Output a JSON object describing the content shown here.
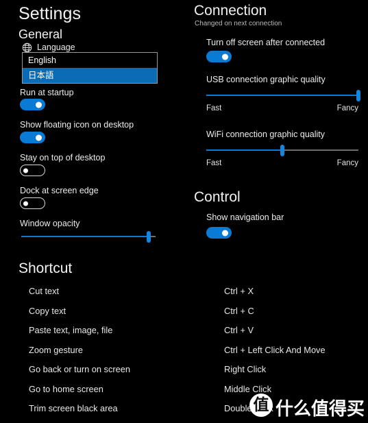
{
  "window": {
    "title": "Settings",
    "background": "#000000",
    "accent": "#0a7bd4"
  },
  "general": {
    "heading": "General",
    "language": {
      "icon": "globe-icon",
      "label": "Language",
      "selected_value": "日本語",
      "options": [
        "English",
        "日本語"
      ],
      "expanded": true
    },
    "toggles": [
      {
        "label": "Run at startup",
        "state": "on"
      },
      {
        "label": "Show floating icon on desktop",
        "state": "on"
      },
      {
        "label": "Stay on top of desktop",
        "state": "off"
      },
      {
        "label": "Dock at screen edge",
        "state": "off"
      }
    ],
    "opacity_slider": {
      "label": "Window opacity",
      "value_percent": 95,
      "min_label": "",
      "max_label": ""
    }
  },
  "connection": {
    "heading": "Connection",
    "note": "Changed on next connection",
    "toggle": {
      "label": "Turn off screen after connected",
      "state": "on"
    },
    "usb_slider": {
      "label": "USB connection graphic quality",
      "value_percent": 100,
      "min_label": "Fast",
      "max_label": "Fancy"
    },
    "wifi_slider": {
      "label": "WiFi connection graphic quality",
      "value_percent": 50,
      "min_label": "Fast",
      "max_label": "Fancy"
    }
  },
  "control": {
    "heading": "Control",
    "toggle": {
      "label": "Show navigation bar",
      "state": "on"
    }
  },
  "shortcut": {
    "heading": "Shortcut",
    "rows": [
      {
        "action": "Cut text",
        "keys": "Ctrl + X"
      },
      {
        "action": "Copy text",
        "keys": "Ctrl + C"
      },
      {
        "action": "Paste text, image, file",
        "keys": "Ctrl + V"
      },
      {
        "action": "Zoom gesture",
        "keys": "Ctrl + Left Click And Move"
      },
      {
        "action": "Go back or turn on screen",
        "keys": "Right Click"
      },
      {
        "action": "Go to home screen",
        "keys": "Middle Click"
      },
      {
        "action": "Trim screen black area",
        "keys": "Double Click"
      }
    ]
  },
  "watermark": {
    "badge": "值",
    "text": "什么值得买"
  }
}
